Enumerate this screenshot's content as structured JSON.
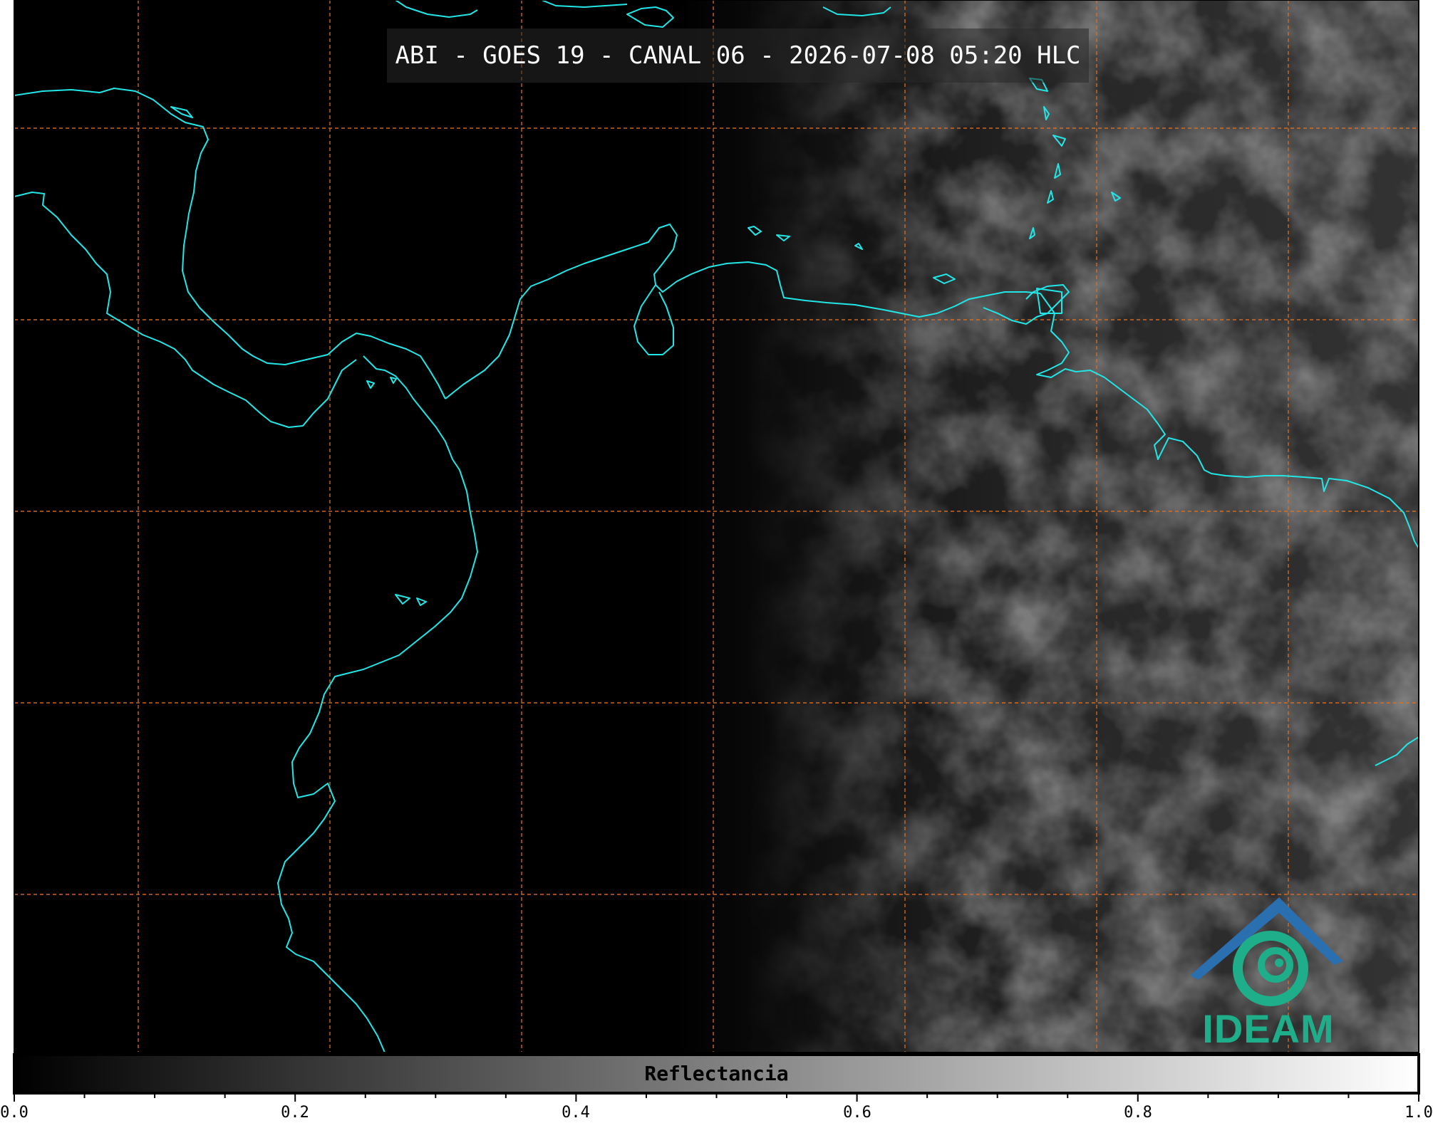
{
  "title": "ABI - GOES 19 - CANAL 06 - 2026-07-08 05:20 HLC",
  "colorbar": {
    "label": "Reflectancia",
    "ticks": [
      "0.0",
      "0.2",
      "0.4",
      "0.6",
      "0.8",
      "1.0"
    ],
    "range": [
      0.0,
      1.0
    ],
    "colormap": [
      "#000000",
      "#ffffff"
    ]
  },
  "map": {
    "coastline_color": "#00ffff",
    "gridline_color": "#e07020",
    "gridline_style": "dashed",
    "background": "#000000"
  },
  "logo": {
    "text": "IDEAM",
    "roof_color": "#2a6fb0",
    "swirl_color": "#1fae8a"
  }
}
